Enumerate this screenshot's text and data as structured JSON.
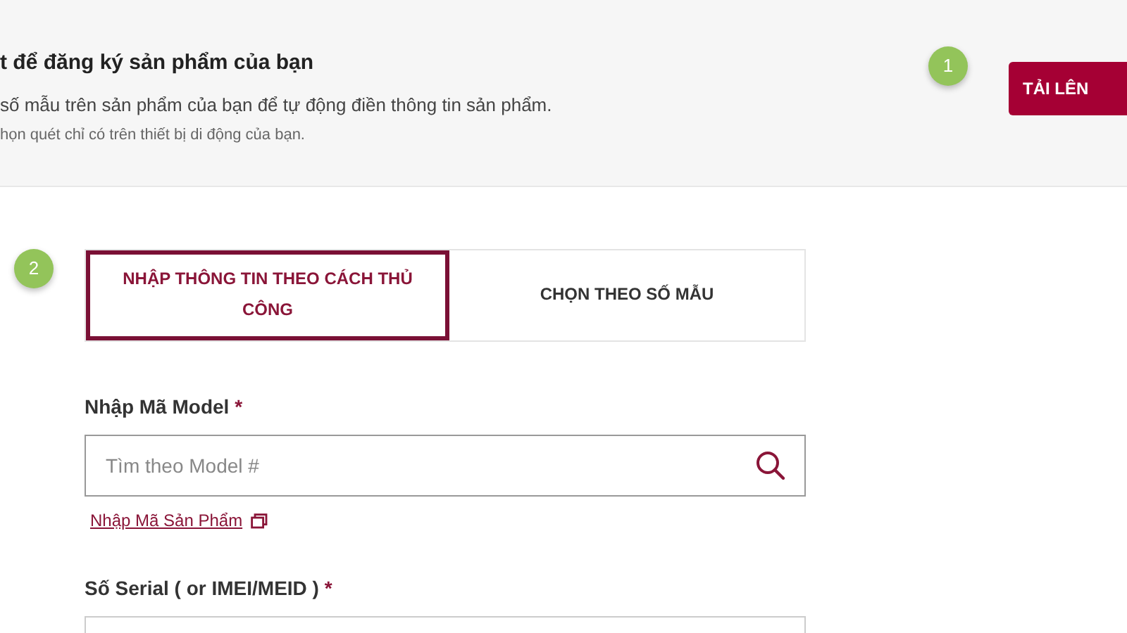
{
  "header": {
    "title": "t để đăng ký sản phẩm của bạn",
    "description": "số mẫu trên sản phẩm của bạn để tự động điền thông tin sản phẩm.",
    "note": "họn quét chỉ có trên thiết bị di động của bạn.",
    "step": "1",
    "button": "TẢI LÊN"
  },
  "form": {
    "step": "2",
    "tabs": [
      {
        "label": "NHẬP THÔNG TIN THEO CÁCH THỦ CÔNG",
        "selected": true
      },
      {
        "label": "CHỌN THEO SỐ MẪU",
        "selected": false
      }
    ],
    "model_label": "Nhập Mã Model",
    "model_required": "*",
    "model_placeholder": "Tìm theo Model #",
    "product_code_link": "Nhập Mã Sản Phẩm",
    "serial_label": "Số Serial ( or IMEI/MEID )",
    "serial_required": "*"
  }
}
